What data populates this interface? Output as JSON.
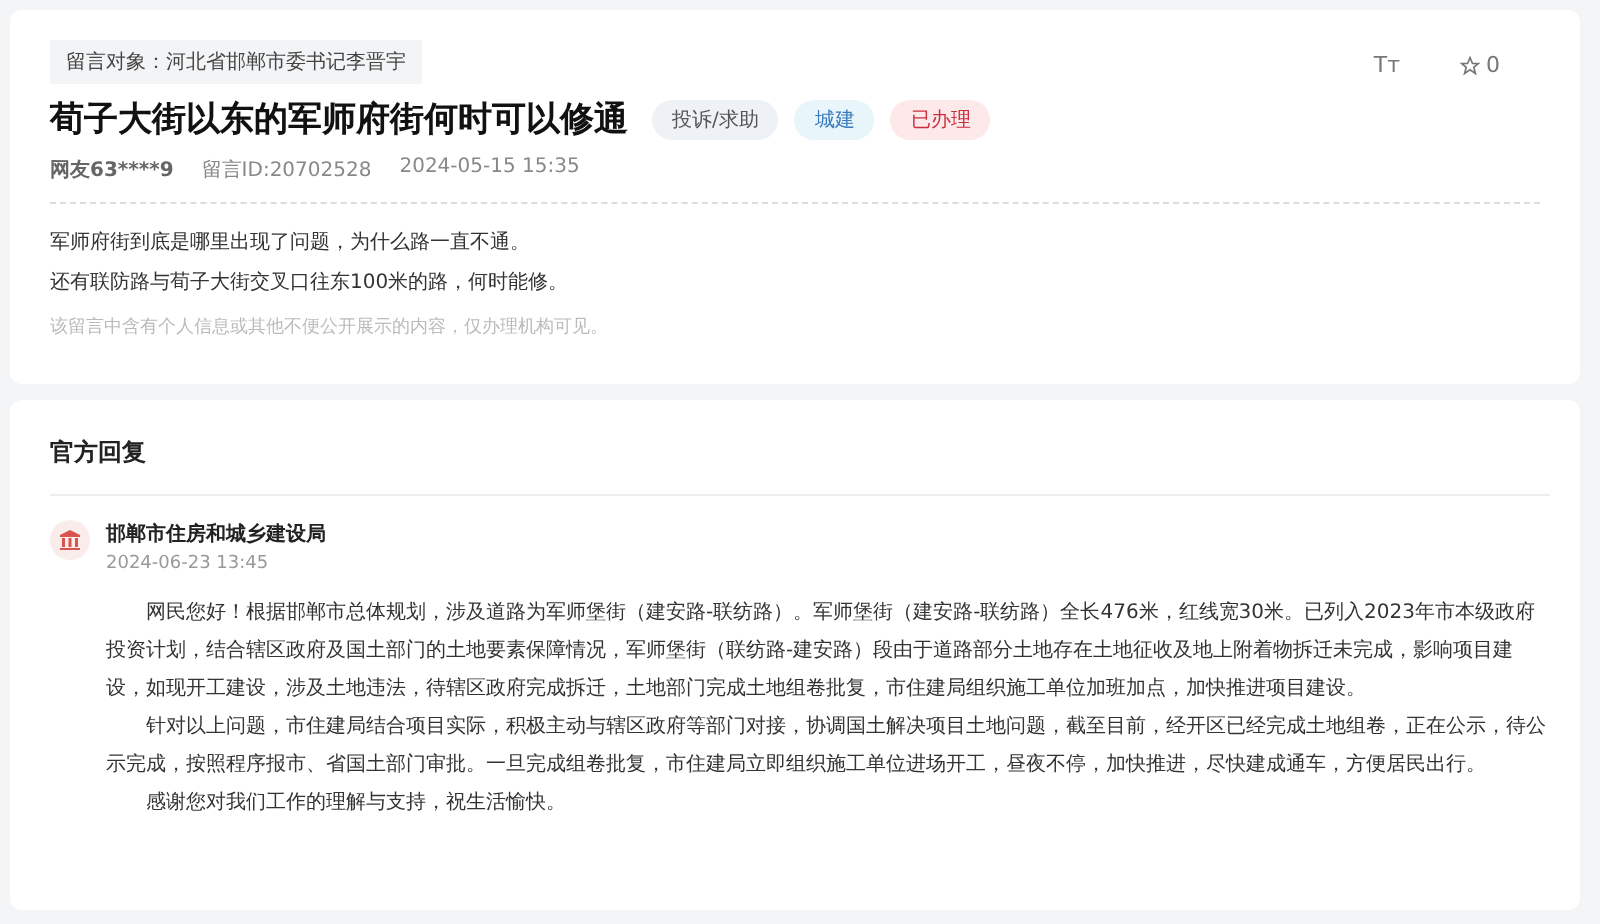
{
  "message": {
    "target": "留言对象：河北省邯郸市委书记李晋宇",
    "title": "荀子大街以东的军师府街何时可以修通",
    "tags": [
      {
        "label": "投诉/求助",
        "kind": "type"
      },
      {
        "label": "城建",
        "kind": "field"
      },
      {
        "label": "已办理",
        "kind": "status"
      }
    ],
    "font_toggle": "Tт",
    "favorites": "0",
    "author": "网友63****9",
    "message_id": "留言ID:20702528",
    "time": "2024-05-15 15:35",
    "body": [
      "军师府街到底是哪里出现了问题，为什么路一直不通。",
      "还有联防路与荀子大街交叉口往东100米的路，何时能修。"
    ],
    "privacy_note": "该留言中含有个人信息或其他不便公开展示的内容，仅办理机构可见。"
  },
  "reply": {
    "heading": "官方回复",
    "agency": "邯郸市住房和城乡建设局",
    "time": "2024-06-23 13:45",
    "paragraphs": [
      "网民您好！根据邯郸市总体规划，涉及道路为军师堡街（建安路-联纺路）。军师堡街（建安路-联纺路）全长476米，红线宽30米。已列入2023年市本级政府投资计划，结合辖区政府及国土部门的土地要素保障情况，军师堡街（联纺路-建安路）段由于道路部分土地存在土地征收及地上附着物拆迁未完成，影响项目建设，如现开工建设，涉及土地违法，待辖区政府完成拆迁，土地部门完成土地组卷批复，市住建局组织施工单位加班加点，加快推进项目建设。",
      "针对以上问题，市住建局结合项目实际，积极主动与辖区政府等部门对接，协调国土解决项目土地问题，截至目前，经开区已经完成土地组卷，正在公示，待公示完成，按照程序报市、省国土部门审批。一旦完成组卷批复，市住建局立即组织施工单位进场开工，昼夜不停，加快推进，尽快建成通车，方便居民出行。",
      "感谢您对我们工作的理解与支持，祝生活愉快。"
    ]
  }
}
